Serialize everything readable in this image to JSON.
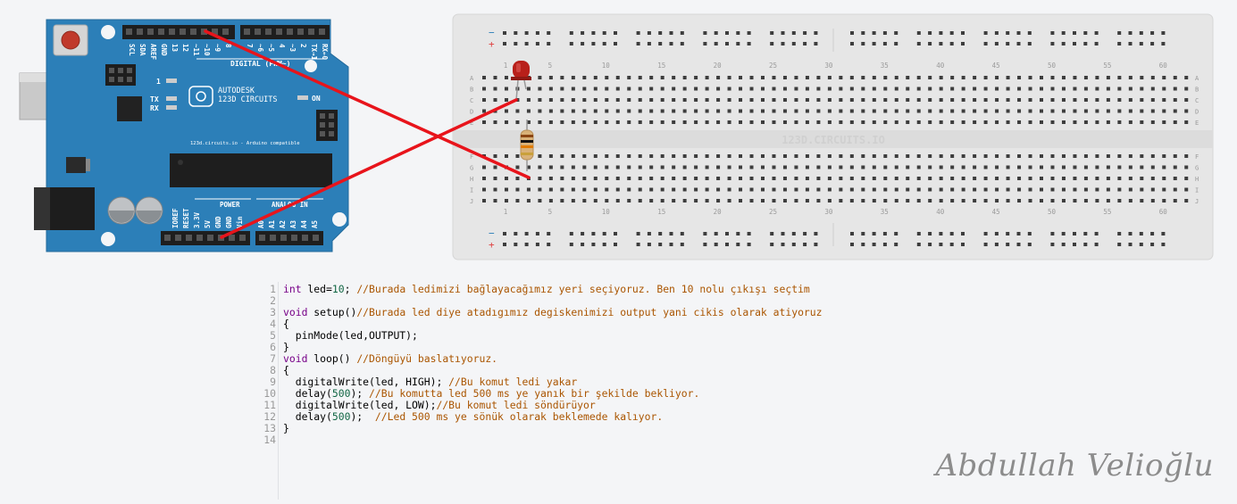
{
  "arduino": {
    "brand_line1": "AUTODESK",
    "brand_line2": "123D CIRCUITS",
    "url_text": "123d.circuits.io - Arduino compatible",
    "digital_label": "DIGITAL (PWM~)",
    "power_label": "POWER",
    "analog_label": "ANALOG IN",
    "on_label": "ON",
    "tx_label": "TX",
    "rx_label": "RX",
    "l_label": "1",
    "top_pins": [
      "SCL",
      "SDA",
      "AREF",
      "GND",
      "13",
      "12",
      "~11",
      "~10",
      "~9",
      "8",
      "7",
      "~6",
      "~5",
      "4",
      "~3",
      "2",
      "TX→1",
      "RX←0"
    ],
    "bottom_pins": [
      "IOREF",
      "RESET",
      "3.3V",
      "5V",
      "GND",
      "GND",
      "Vin",
      "A0",
      "A1",
      "A2",
      "A3",
      "A4",
      "A5"
    ]
  },
  "breadboard": {
    "watermark": "123D.CIRCUITS.IO",
    "column_numbers": [
      "1",
      "5",
      "10",
      "15",
      "20",
      "25",
      "30",
      "35",
      "40",
      "45",
      "50",
      "55",
      "60"
    ],
    "row_letters_top": [
      "A",
      "B",
      "C",
      "D",
      "E"
    ],
    "row_letters_bottom": [
      "F",
      "G",
      "H",
      "I",
      "J"
    ],
    "rail_minus": "−",
    "rail_plus": "+"
  },
  "code": {
    "lines": [
      {
        "n": "1",
        "parts": [
          {
            "t": "int",
            "c": "kw"
          },
          {
            "t": " led=",
            "c": "tx"
          },
          {
            "t": "10",
            "c": "num"
          },
          {
            "t": "; ",
            "c": "tx"
          },
          {
            "t": "//Burada ledimizi bağlayacağımız yeri seçiyoruz. Ben 10 nolu çıkışı seçtim",
            "c": "cm"
          }
        ]
      },
      {
        "n": "2",
        "parts": []
      },
      {
        "n": "3",
        "parts": [
          {
            "t": "void",
            "c": "kw"
          },
          {
            "t": " setup()",
            "c": "tx"
          },
          {
            "t": "//Burada led diye atadıgımız degiskenimizi output yani cikis olarak atiyoruz",
            "c": "cm"
          }
        ]
      },
      {
        "n": "4",
        "parts": [
          {
            "t": "{",
            "c": "tx"
          }
        ]
      },
      {
        "n": "5",
        "parts": [
          {
            "t": "  pinMode(led,OUTPUT);",
            "c": "tx"
          }
        ]
      },
      {
        "n": "6",
        "parts": [
          {
            "t": "}",
            "c": "tx"
          }
        ]
      },
      {
        "n": "7",
        "parts": [
          {
            "t": "void",
            "c": "kw"
          },
          {
            "t": " loop() ",
            "c": "tx"
          },
          {
            "t": "//Döngüyü baslatıyoruz.",
            "c": "cm"
          }
        ]
      },
      {
        "n": "8",
        "parts": [
          {
            "t": "{",
            "c": "tx"
          }
        ]
      },
      {
        "n": "9",
        "parts": [
          {
            "t": "  digitalWrite(led, HIGH); ",
            "c": "tx"
          },
          {
            "t": "//Bu komut ledi yakar",
            "c": "cm"
          }
        ]
      },
      {
        "n": "10",
        "parts": [
          {
            "t": "  delay(",
            "c": "tx"
          },
          {
            "t": "500",
            "c": "num"
          },
          {
            "t": "); ",
            "c": "tx"
          },
          {
            "t": "//Bu komutta led 500 ms ye yanık bir şekilde bekliyor.",
            "c": "cm"
          }
        ]
      },
      {
        "n": "11",
        "parts": [
          {
            "t": "  digitalWrite(led, LOW);",
            "c": "tx"
          },
          {
            "t": "//Bu komut ledi söndürüyor",
            "c": "cm"
          }
        ]
      },
      {
        "n": "12",
        "parts": [
          {
            "t": "  delay(",
            "c": "tx"
          },
          {
            "t": "500",
            "c": "num"
          },
          {
            "t": ");  ",
            "c": "tx"
          },
          {
            "t": "//Led 500 ms ye sönük olarak beklemede kalıyor.",
            "c": "cm"
          }
        ]
      },
      {
        "n": "13",
        "parts": [
          {
            "t": "}",
            "c": "tx"
          }
        ]
      },
      {
        "n": "14",
        "parts": []
      }
    ]
  },
  "signature": "Abdullah Velioğlu",
  "colors": {
    "board": "#2c7fb8",
    "wire": "#e8141b",
    "led": "#b8201a",
    "breadboard": "#e6e6e6"
  }
}
